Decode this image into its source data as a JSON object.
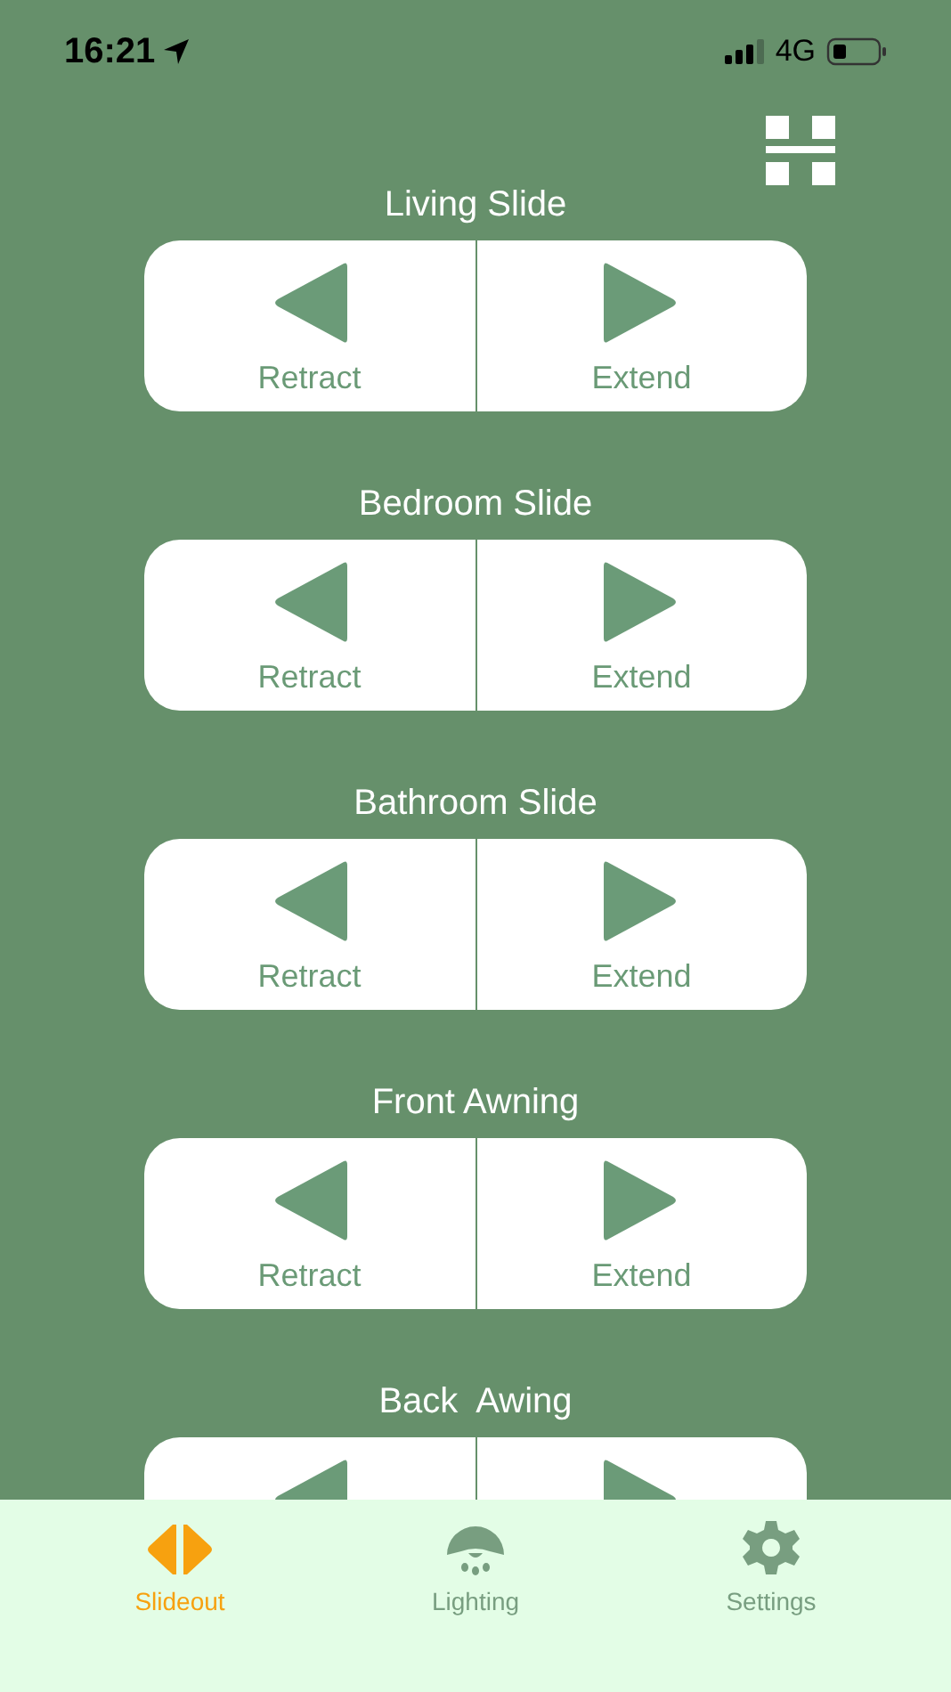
{
  "status_bar": {
    "time": "16:21",
    "network": "4G"
  },
  "sections": [
    {
      "title": "Living Slide",
      "buttons": [
        {
          "kind": "retract",
          "label": "Retract"
        },
        {
          "kind": "extend",
          "label": "Extend"
        }
      ]
    },
    {
      "title": "Bedroom Slide",
      "buttons": [
        {
          "kind": "retract",
          "label": "Retract"
        },
        {
          "kind": "extend",
          "label": "Extend"
        }
      ]
    },
    {
      "title": "Bathroom Slide",
      "buttons": [
        {
          "kind": "retract",
          "label": "Retract"
        },
        {
          "kind": "extend",
          "label": "Extend"
        }
      ]
    },
    {
      "title": "Front Awning",
      "buttons": [
        {
          "kind": "retract",
          "label": "Retract"
        },
        {
          "kind": "extend",
          "label": "Extend"
        }
      ]
    },
    {
      "title": "Back  Awing",
      "buttons": [
        {
          "kind": "retract"
        },
        {
          "kind": "extend"
        }
      ]
    }
  ],
  "tabs": [
    {
      "kind": "slideout",
      "label": "Slideout",
      "selected": true
    },
    {
      "kind": "lighting",
      "label": "Lighting",
      "selected": false
    },
    {
      "kind": "settings",
      "label": "Settings",
      "selected": false
    }
  ]
}
